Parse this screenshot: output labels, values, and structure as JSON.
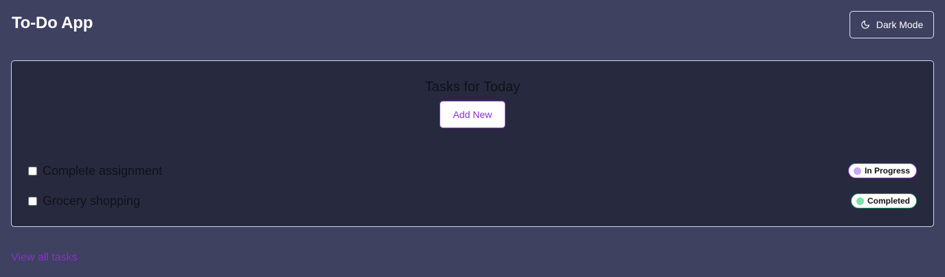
{
  "header": {
    "title": "To-Do App",
    "mode_button": {
      "icon": "moon-icon",
      "label": "Dark Mode"
    }
  },
  "tasks_card": {
    "title": "Tasks for Today",
    "add_button_label": "Add New",
    "tasks": [
      {
        "label": "Complete assignment",
        "checked": false,
        "status": "In Progress",
        "status_color": "#c7a8f5",
        "badge_border": "#9b3fd6"
      },
      {
        "label": "Grocery shopping",
        "checked": false,
        "status": "Completed",
        "status_color": "#7fe0a8",
        "badge_border": "#22a060"
      }
    ]
  },
  "footer": {
    "link_label": "View all tasks"
  },
  "colors": {
    "page_background": "#3e4160",
    "card_background": "#272a3e",
    "accent": "#8a2fd0"
  }
}
